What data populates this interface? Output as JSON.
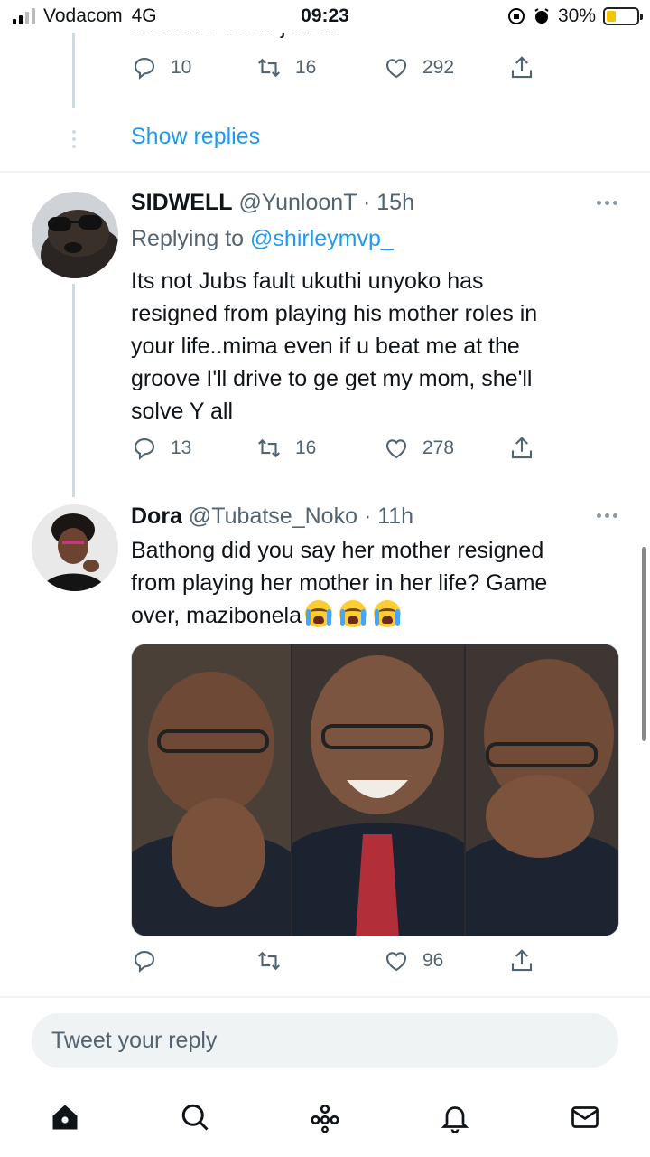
{
  "status_bar": {
    "carrier": "Vodacom",
    "network": "4G",
    "time": "09:23",
    "battery": "30%",
    "battery_level": 0.3
  },
  "prev_tweet": {
    "text_tail": "would've been jailed.",
    "replies": "10",
    "retweets": "16",
    "likes": "292",
    "show_replies": "Show replies"
  },
  "tweet1": {
    "name": "SIDWELL",
    "handle": "@YunloonT",
    "time": "· 15h",
    "replying_to_label": "Replying to",
    "replying_to": "@shirleymvp_",
    "lines": [
      "Its not Jubs fault ukuthi unyoko has",
      "resigned from playing his mother roles in",
      "your life..mima even if u beat me at the",
      "groove I'll drive to ge get my mom, she'll",
      "solve Y all"
    ],
    "replies": "13",
    "retweets": "16",
    "likes": "278"
  },
  "tweet2": {
    "name": "Dora",
    "handle": "@Tubatse_Noko",
    "time": "· 11h",
    "lines": [
      "Bathong did you say her mother resigned",
      "from playing her mother in her life? Game",
      "over, mazibonela"
    ],
    "likes": "96"
  },
  "reply_input": {
    "placeholder": "Tweet your reply"
  },
  "icons": {
    "reply": "reply-icon",
    "retweet": "retweet-icon",
    "like": "heart-icon",
    "share": "share-icon",
    "more": "more-icon",
    "home": "home-icon",
    "search": "search-icon",
    "spaces": "spaces-icon",
    "notifications": "bell-icon",
    "messages": "mail-icon"
  },
  "colors": {
    "accent": "#1d9bf0",
    "secondary_text": "#536471",
    "battery": "#f5c400"
  }
}
